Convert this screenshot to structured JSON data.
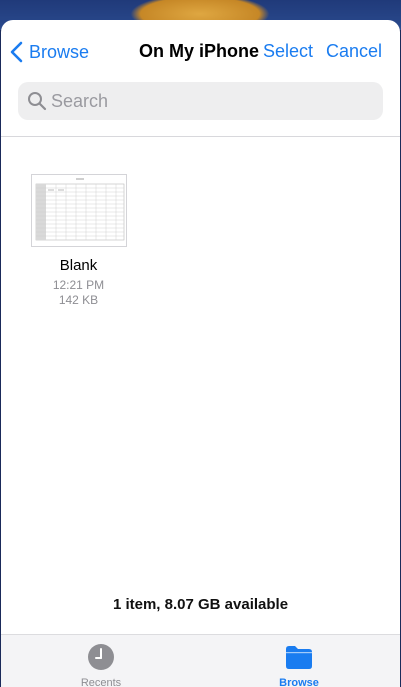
{
  "nav": {
    "back_label": "Browse",
    "title": "On My iPhone",
    "select_label": "Select",
    "cancel_label": "Cancel"
  },
  "search": {
    "placeholder": "Search"
  },
  "files": [
    {
      "name": "Blank",
      "time": "12:21 PM",
      "size": "142 KB"
    }
  ],
  "footer": {
    "storage_text": "1 item, 8.07 GB available"
  },
  "tabbar": {
    "recents_label": "Recents",
    "browse_label": "Browse",
    "active": "Browse"
  },
  "colors": {
    "accent": "#1a7cf0",
    "inactive": "#8e8e93"
  }
}
